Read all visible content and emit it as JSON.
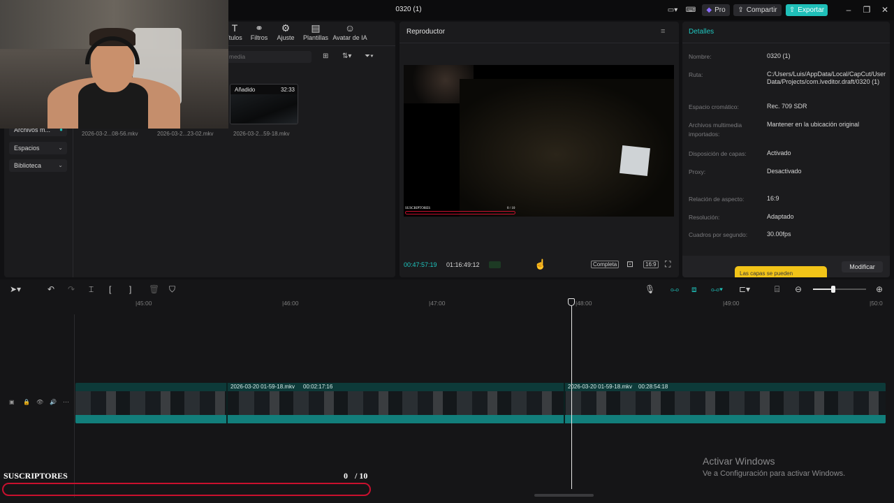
{
  "window": {
    "title": "0320 (1)",
    "pro_label": "Pro",
    "share_label": "Compartir",
    "export_label": "Exportar"
  },
  "toolbar": {
    "tabs": [
      {
        "label": "ítulos",
        "icon": "text-icon"
      },
      {
        "label": "Filtros",
        "icon": "filters-icon"
      },
      {
        "label": "Ajuste",
        "icon": "adjust-icon"
      },
      {
        "label": "Plantillas",
        "icon": "templates-icon"
      },
      {
        "label": "Avatar de IA",
        "icon": "ai-avatar-icon"
      }
    ]
  },
  "media": {
    "search_placeholder": "media",
    "sidebar": [
      {
        "label": "Archivos m..."
      },
      {
        "label": "Espacios"
      },
      {
        "label": "Biblioteca"
      }
    ],
    "thumb": {
      "badge": "Añadido",
      "duration": "32:33"
    },
    "files": [
      "2026-03-2...08-56.mkv",
      "2026-03-2...23-02.mkv",
      "2026-03-2...59-18.mkv"
    ]
  },
  "player": {
    "title": "Reproductor",
    "current_time": "00:47:57:19",
    "total_time": "01:16:49:12",
    "full_label": "Completa",
    "ratio_label": "16:9",
    "overlay_title": "SUSCRIPTORES",
    "overlay_count": "0 / 10"
  },
  "details": {
    "title": "Detalles",
    "rows": [
      {
        "label": "Nombre:",
        "value": "0320 (1)"
      },
      {
        "label": "Ruta:",
        "value": "C:/Users/Luis/AppData/Local/CapCut/User Data/Projects/com.lveditor.draft/0320 (1)"
      },
      {
        "label": "Espacio cromático:",
        "value": "Rec. 709 SDR"
      },
      {
        "label": "Archivos multimedia importados:",
        "value": "Mantener en la ubicación original"
      },
      {
        "label": "Disposición de capas:",
        "value": "Activado"
      },
      {
        "label": "Proxy:",
        "value": "Desactivado"
      },
      {
        "label": "Relación de aspecto:",
        "value": "16:9"
      },
      {
        "label": "Resolución:",
        "value": "Adaptado"
      },
      {
        "label": "Cuadros por segundo:",
        "value": "30.00fps"
      }
    ],
    "tooltip": "Las capas se pueden",
    "modify_label": "Modificar"
  },
  "timeline": {
    "ruler": [
      "|45:00",
      "|46:00",
      "|47:00",
      "|48:00",
      "|49:00",
      "|50:0"
    ],
    "clips": [
      {
        "name": "2026-03-20 01-59-18.mkv",
        "duration": "00:02:17:16"
      },
      {
        "name": "2026-03-20 01-59-18.mkv",
        "duration": "00:28:54:18"
      }
    ]
  },
  "subscribers": {
    "label": "SUSCRIPTORES",
    "count": "0",
    "goal": "/ 10",
    "progress": 0
  },
  "watermark": {
    "line1": "Activar Windows",
    "line2": "Ve a Configuración para activar Windows."
  },
  "colors": {
    "accent": "#1fc7c0",
    "export": "#1fbfb8",
    "pro": "#7b5cff",
    "tooltip": "#f2c418",
    "progress_border": "#c8102e"
  }
}
